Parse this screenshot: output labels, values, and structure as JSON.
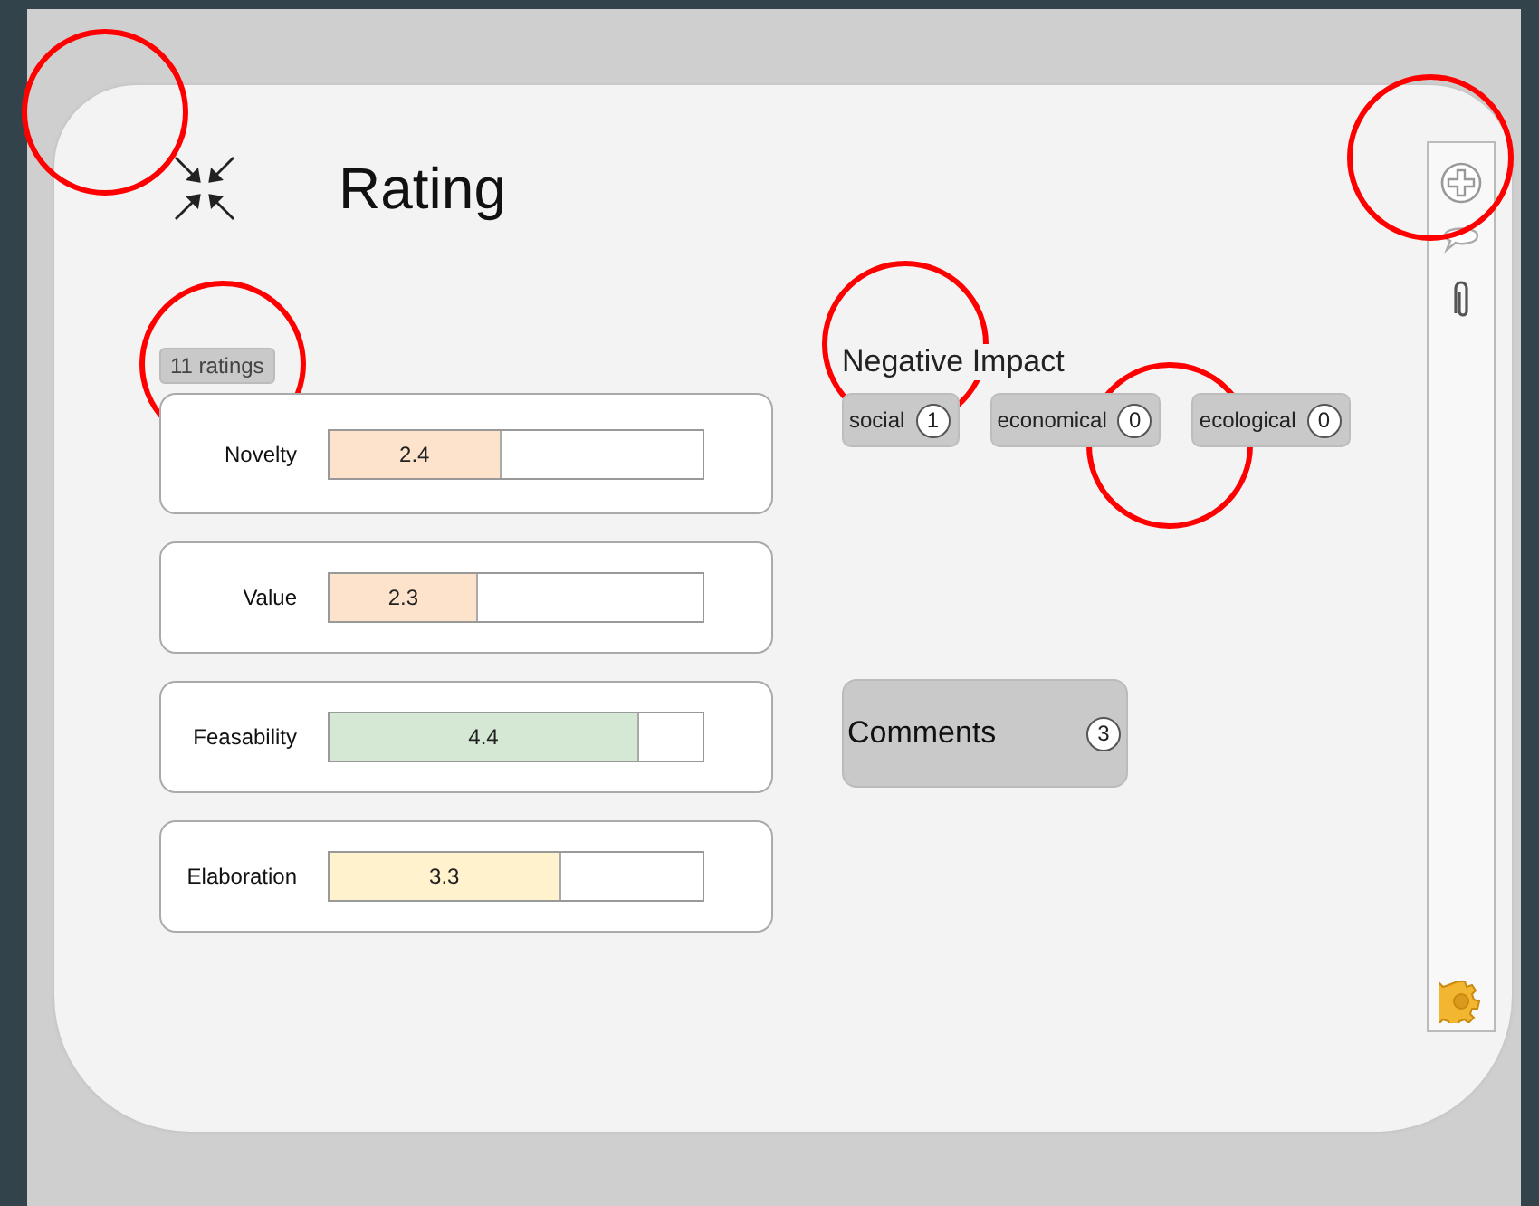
{
  "title": "Rating",
  "ratings_count": "11 ratings",
  "criteria": [
    {
      "name": "Novelty",
      "value": "2.4",
      "level": 0.46,
      "color": "#fde3cb"
    },
    {
      "name": "Value",
      "value": "2.3",
      "level": 0.4,
      "color": "#fde3cb"
    },
    {
      "name": "Feasability",
      "value": "4.4",
      "level": 0.83,
      "color": "#d5e8d4"
    },
    {
      "name": "Elaboration",
      "value": "3.3",
      "level": 0.62,
      "color": "#fff2cc"
    }
  ],
  "negative_impact": {
    "heading": "Negative Impact",
    "tags": [
      {
        "label": "social",
        "count": "1"
      },
      {
        "label": "economical",
        "count": "0"
      },
      {
        "label": "ecological",
        "count": "0"
      }
    ]
  },
  "comments": {
    "label": "Comments",
    "count": "3"
  },
  "toolbar": [
    {
      "kind": "add"
    },
    {
      "kind": "comment"
    },
    {
      "kind": "attach"
    },
    {
      "kind": "settings"
    }
  ],
  "annotations": [
    {
      "kind": "circle"
    },
    {
      "kind": "circle"
    },
    {
      "kind": "circle"
    },
    {
      "kind": "circle"
    },
    {
      "kind": "circle"
    }
  ]
}
